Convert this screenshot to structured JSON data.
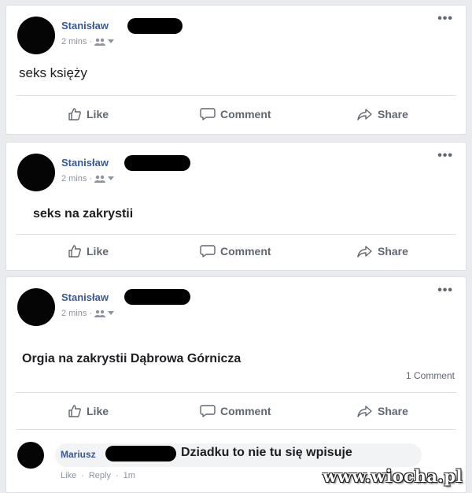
{
  "posts": [
    {
      "author": "Stanisław",
      "time": "2 mins",
      "text": "seks księży",
      "actions": {
        "like": "Like",
        "comment": "Comment",
        "share": "Share"
      }
    },
    {
      "author": "Stanisław",
      "time": "2 mins",
      "text": "seks na zakrystii",
      "actions": {
        "like": "Like",
        "comment": "Comment",
        "share": "Share"
      }
    },
    {
      "author": "Stanisław",
      "time": "2 mins",
      "text": "Orgia na zakrystii Dąbrowa Górnicza",
      "comment_count": "1 Comment",
      "actions": {
        "like": "Like",
        "comment": "Comment",
        "share": "Share"
      },
      "comment": {
        "author": "Mariusz",
        "text": "Dziadku to nie tu się wpisuje",
        "like": "Like",
        "reply": "Reply",
        "time": "1m"
      }
    }
  ],
  "menu_glyph": "•••",
  "watermark": "www.wiocha.pl",
  "colors": {
    "background": "#e9ebee",
    "card": "#ffffff",
    "author_link": "#385898",
    "muted_text": "#606770",
    "redaction": "#000000"
  },
  "icons": [
    "audience-friends-icon",
    "chevron-down-icon",
    "thumbs-up-icon",
    "comment-bubble-icon",
    "share-arrow-icon",
    "more-options-icon"
  ]
}
